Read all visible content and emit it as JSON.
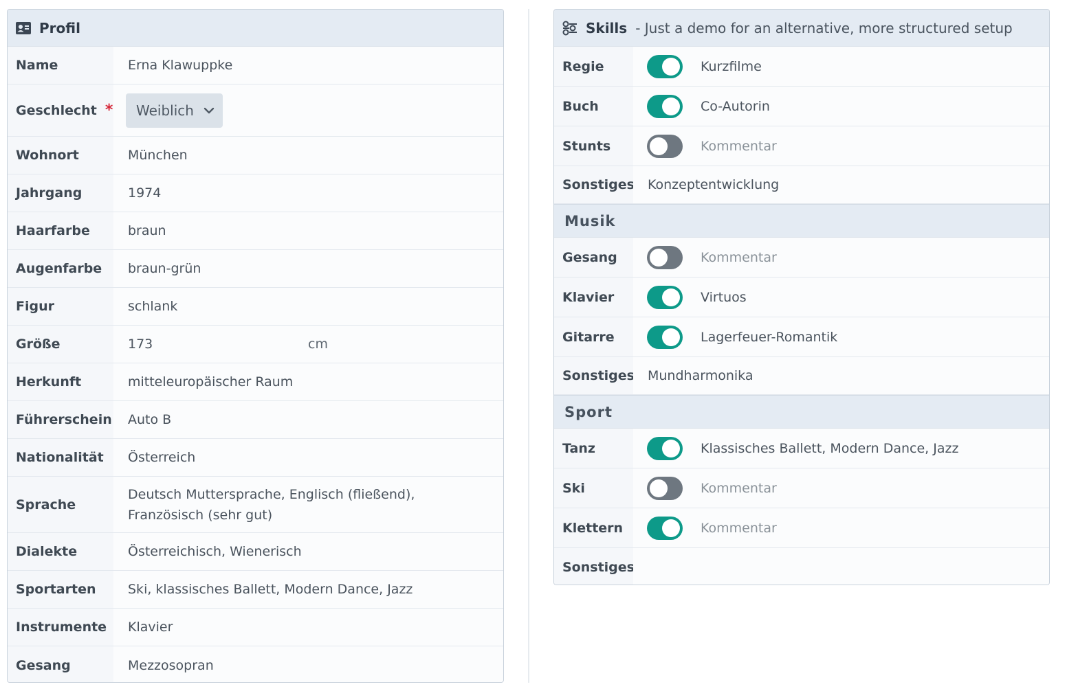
{
  "profil": {
    "title": "Profil",
    "icon": "id-card-icon",
    "rows": [
      {
        "label": "Name",
        "value": "Erna Klawuppke"
      },
      {
        "label": "Geschlecht",
        "required": "*",
        "select": "Weiblich"
      },
      {
        "label": "Wohnort",
        "value": "München"
      },
      {
        "label": "Jahrgang",
        "value": "1974"
      },
      {
        "label": "Haarfarbe",
        "value": "braun"
      },
      {
        "label": "Augenfarbe",
        "value": "braun-grün"
      },
      {
        "label": "Figur",
        "value": "schlank"
      },
      {
        "label": "Größe",
        "value": "173",
        "unit": "cm"
      },
      {
        "label": "Herkunft",
        "value": "mitteleuropäischer Raum"
      },
      {
        "label": "Führerschein",
        "value": "Auto B"
      },
      {
        "label": "Nationalität",
        "value": "Österreich"
      },
      {
        "label": "Sprache",
        "value": "Deutsch Muttersprache, Englisch (fließend), Französisch (sehr gut)"
      },
      {
        "label": "Dialekte",
        "value": "Österreichisch, Wienerisch"
      },
      {
        "label": "Sportarten",
        "value": "Ski, klassisches Ballett, Modern Dance, Jazz"
      },
      {
        "label": "Instrumente",
        "value": "Klavier"
      },
      {
        "label": "Gesang",
        "value": "Mezzosopran"
      }
    ]
  },
  "skills": {
    "title": "Skills",
    "subtitle": "- Just a demo for an alternative, more structured setup",
    "icon": "sliders-icon",
    "film_rows": [
      {
        "label": "Regie",
        "on": true,
        "text": "Kurzfilme"
      },
      {
        "label": "Buch",
        "on": true,
        "text": "Co-Autorin"
      },
      {
        "label": "Stunts",
        "on": false,
        "text": "Kommentar"
      },
      {
        "label": "Sonstiges",
        "text": "Konzeptentwicklung"
      }
    ],
    "musik": {
      "title": "Musik",
      "rows": [
        {
          "label": "Gesang",
          "on": false,
          "text": "Kommentar"
        },
        {
          "label": "Klavier",
          "on": true,
          "text": "Virtuos"
        },
        {
          "label": "Gitarre",
          "on": true,
          "text": "Lagerfeuer-Romantik"
        },
        {
          "label": "Sonstiges",
          "text": "Mundharmonika"
        }
      ]
    },
    "sport": {
      "title": "Sport",
      "rows": [
        {
          "label": "Tanz",
          "on": true,
          "text": "Klassisches Ballett, Modern Dance, Jazz"
        },
        {
          "label": "Ski",
          "on": false,
          "text": "Kommentar"
        },
        {
          "label": "Klettern",
          "on": true,
          "text": "Kommentar"
        },
        {
          "label": "Sonstiges",
          "text": ""
        }
      ]
    }
  },
  "colors": {
    "toggle_on": "#0d9a89",
    "toggle_off": "#6e7780",
    "header_bg": "#e4ebf3",
    "required": "#d6293a"
  }
}
